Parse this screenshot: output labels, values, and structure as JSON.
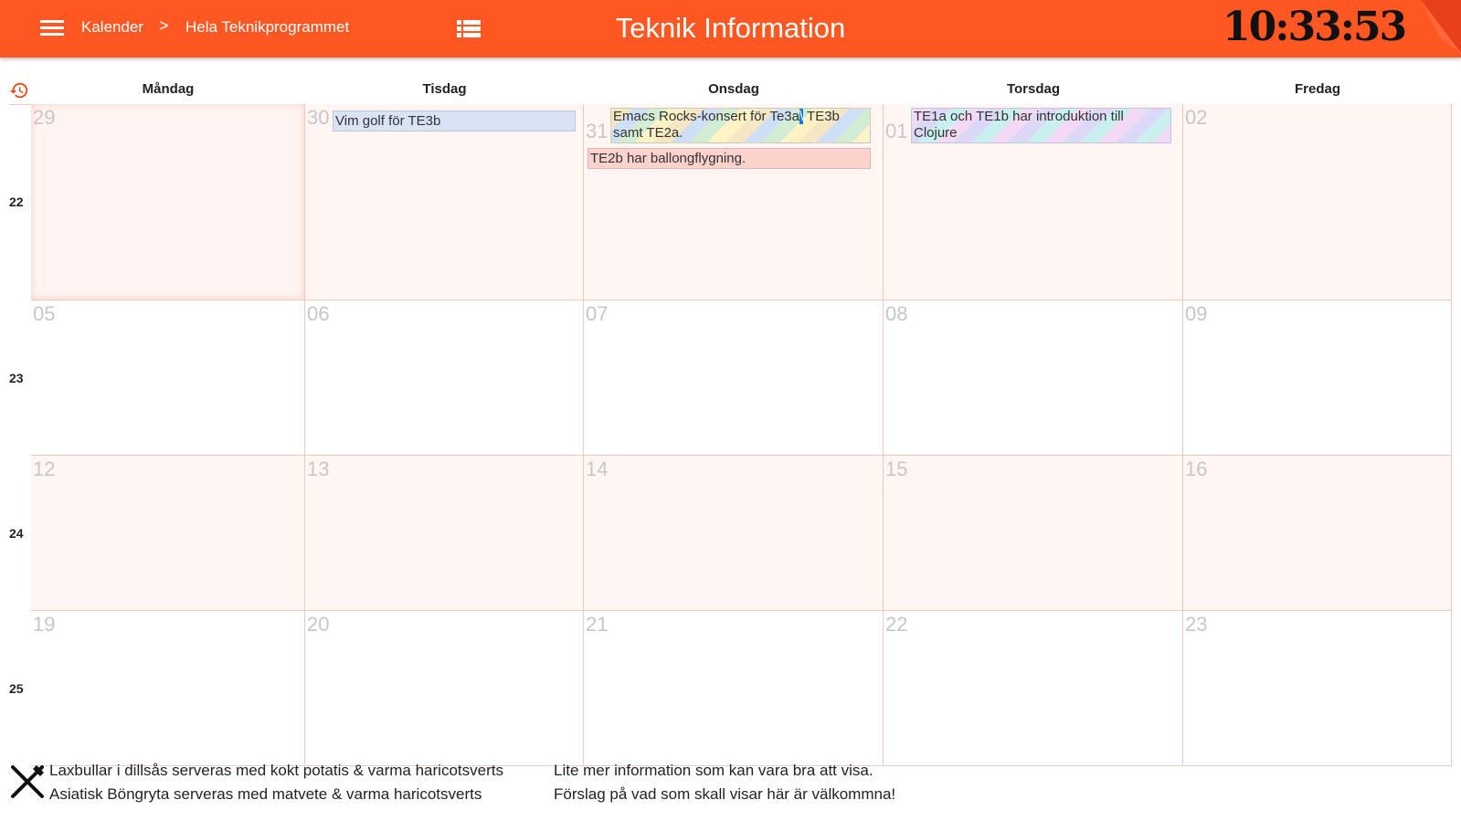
{
  "header": {
    "breadcrumb": [
      "Kalender",
      "Hela Teknikprogrammet"
    ],
    "breadcrumb_separator": ">",
    "title": "Teknik Information",
    "clock": "10:33:53",
    "accent_color": "#ff5722"
  },
  "calendar": {
    "days": [
      "Måndag",
      "Tisdag",
      "Onsdag",
      "Torsdag",
      "Fredag"
    ],
    "weeks": [
      {
        "number": "22",
        "dates": [
          "29",
          "30",
          "31",
          "01",
          "02"
        ]
      },
      {
        "number": "23",
        "dates": [
          "05",
          "06",
          "07",
          "08",
          "09"
        ]
      },
      {
        "number": "24",
        "dates": [
          "12",
          "13",
          "14",
          "15",
          "16"
        ]
      },
      {
        "number": "25",
        "dates": [
          "19",
          "20",
          "21",
          "22",
          "23"
        ]
      }
    ],
    "events": {
      "tue_vim": "Vim golf för TE3b",
      "wed_emacs_a": "Emacs Rocks-konsert för Te3a",
      "wed_emacs_sel": "\\",
      "wed_emacs_b": " TE3b",
      "wed_emacs_c": "samt TE2a.",
      "wed_balloon": "TE2b har ballongflygning.",
      "thu_clojure_a": "TE1a och TE1b har introduktion till",
      "thu_clojure_b": "Clojure"
    }
  },
  "footer": {
    "lunch": [
      "Laxbullar i dillsås serveras med kokt potatis & varma haricotsverts",
      "Asiatisk Böngryta serveras med matvete & varma haricotsverts"
    ],
    "info": [
      "Lite mer information som kan vara bra att visa.",
      "Förslag på vad som skall visar här är välkommna!"
    ]
  },
  "icons": {
    "menu": "menu-icon",
    "view": "list-view-icon",
    "history": "history-icon",
    "food": "cutlery-icon"
  }
}
